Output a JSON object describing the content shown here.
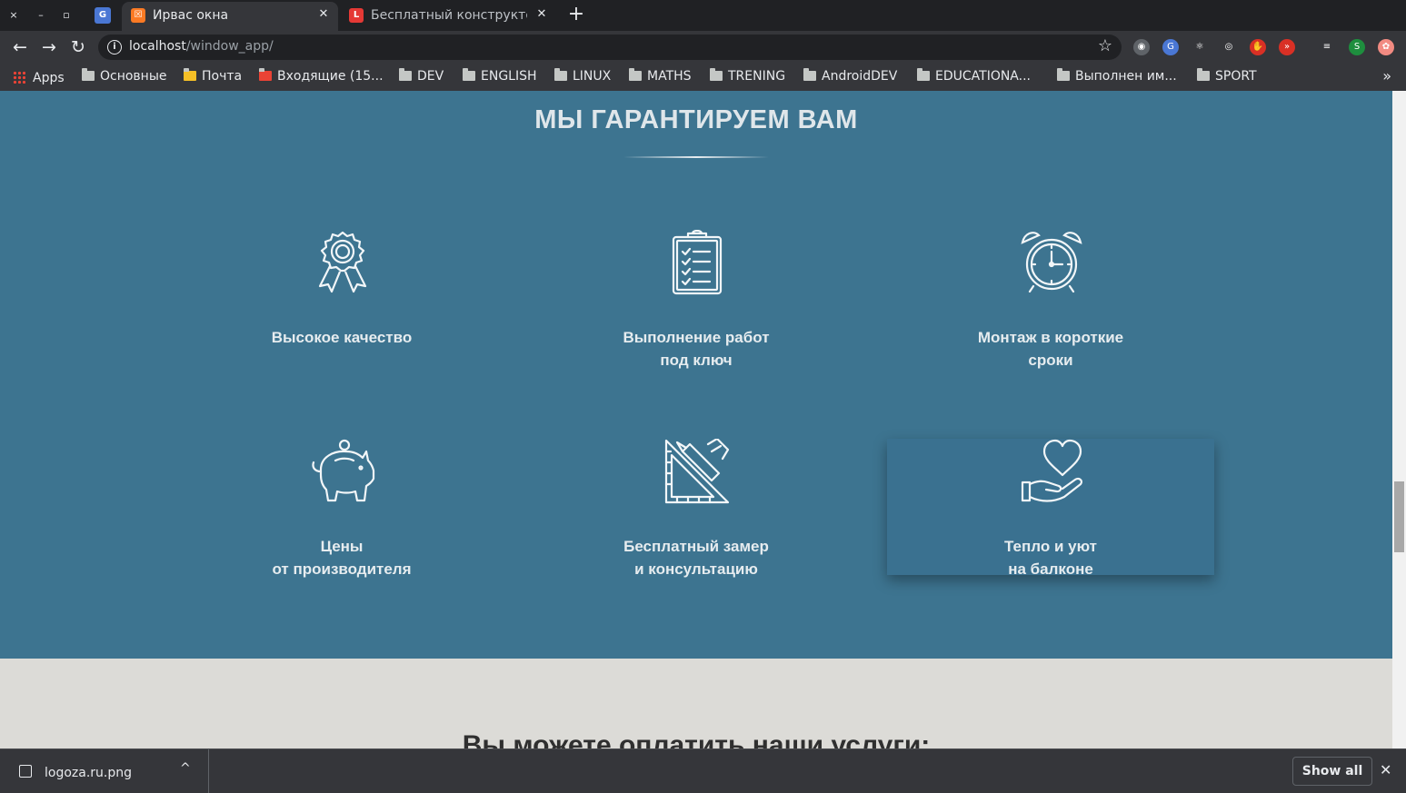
{
  "window": {
    "close": "×",
    "minimize": "–",
    "maximize": "▫"
  },
  "tabs": [
    {
      "title": "Ирвас окна",
      "favicon": "xampp-icon",
      "favicon_color": "#fb7a24",
      "favicon_glyph": "☒",
      "active": true,
      "close": "✕"
    },
    {
      "title": "Бесплатный конструктор",
      "favicon": "l-logo-icon",
      "favicon_color": "#e53935",
      "favicon_glyph": "L",
      "active": false,
      "close": "✕"
    }
  ],
  "tab_solo_icon": {
    "name": "google-translate-icon",
    "glyph": "G"
  },
  "new_tab": "+",
  "nav": {
    "back": "←",
    "forward": "→",
    "reload": "↻"
  },
  "address": {
    "host": "localhost",
    "path": "/window_app/",
    "info": "i",
    "bookmark": "☆"
  },
  "extensions": [
    {
      "name": "incognito-ext-icon",
      "color": "#5f6368",
      "glyph": "◉"
    },
    {
      "name": "translate-ext-icon",
      "color": "#4a77d4",
      "glyph": "G"
    },
    {
      "name": "react-ext-icon",
      "color": "#35363a",
      "glyph": "⚛"
    },
    {
      "name": "target-ext-icon",
      "color": "#35363a",
      "glyph": "◎"
    },
    {
      "name": "adblock-ext-icon",
      "color": "#d93025",
      "glyph": "✋"
    },
    {
      "name": "redirect-ext-icon",
      "color": "#d93025",
      "glyph": "»"
    },
    {
      "name": "media-controls-icon",
      "color": "#35363a",
      "glyph": "≡"
    },
    {
      "name": "profile-avatar-icon",
      "color": "#1e8e3e",
      "glyph": "S"
    },
    {
      "name": "extension-menu-icon",
      "color": "#f28b82",
      "glyph": "✿"
    }
  ],
  "bookmarks": [
    {
      "label": "Apps",
      "type": "apps"
    },
    {
      "label": "Основные",
      "type": "folder"
    },
    {
      "label": "Почта",
      "type": "mail"
    },
    {
      "label": "Входящие (15...",
      "type": "gmail"
    },
    {
      "label": "DEV",
      "type": "folder"
    },
    {
      "label": "ENGLISH",
      "type": "folder"
    },
    {
      "label": "LINUX",
      "type": "folder"
    },
    {
      "label": "MATHS",
      "type": "folder"
    },
    {
      "label": "TRENING",
      "type": "folder"
    },
    {
      "label": "AndroidDEV",
      "type": "folder"
    },
    {
      "label": "EDUCATIONA...",
      "type": "folder"
    },
    {
      "label": "Выполнен им...",
      "type": "folder"
    },
    {
      "label": "SPORT",
      "type": "folder"
    }
  ],
  "bookmarks_more": "»",
  "page": {
    "hero_title": "МЫ ГАРАНТИРУЕМ ВАМ",
    "features": [
      {
        "label": "Высокое качество",
        "icon": "award-icon"
      },
      {
        "label": "Выполнение работ\nпод ключ",
        "icon": "clipboard-checklist-icon"
      },
      {
        "label": "Монтаж в короткие\nсроки",
        "icon": "alarm-clock-icon"
      },
      {
        "label": "Цены\nот производителя",
        "icon": "piggy-bank-icon"
      },
      {
        "label": "Бесплатный замер\nи консультацию",
        "icon": "ruler-pencil-icon"
      },
      {
        "label": "Тепло и уют\nна балконе",
        "icon": "heart-hand-icon"
      }
    ],
    "next_section_title": "Вы можете оплатить наши услуги:"
  },
  "downloads": {
    "file": "logoza.ru.png",
    "caret": "^",
    "show_all": "Show all",
    "close": "✕"
  },
  "colors": {
    "hero_bg": "#3d7490",
    "page_bg": "#dcdbd7",
    "chrome_dark": "#202124",
    "chrome_toolbar": "#35363a"
  }
}
